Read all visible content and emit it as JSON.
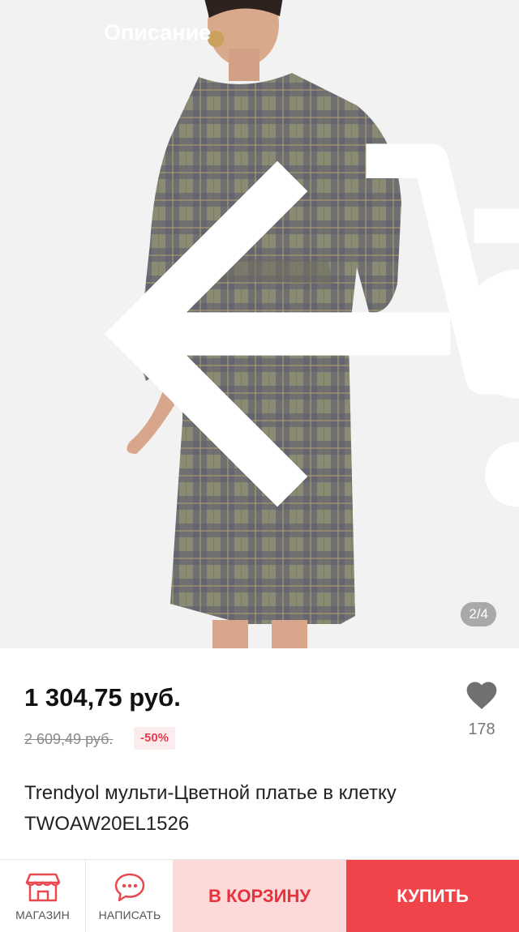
{
  "header": {
    "title": "Описание",
    "icons": [
      "arrow-back-icon",
      "cart-icon",
      "share-icon",
      "more-vert-icon"
    ]
  },
  "gallery": {
    "counter": "2/4",
    "image_subject": "model-in-plaid-dress"
  },
  "product": {
    "price": "1 304,75 руб.",
    "old_price": "2 609,49 руб.",
    "discount": "-50%",
    "favorites_count": "178",
    "name": "Trendyol мульти-Цветной платье в клетку TWOAW20EL1526"
  },
  "bottom_bar": {
    "store_label": "МАГАЗИН",
    "message_label": "НАПИСАТЬ",
    "add_to_cart_label": "В КОРЗИНУ",
    "buy_label": "КУПИТЬ"
  },
  "colors": {
    "accent_red": "#f1444a",
    "cart_bg": "#fdd9d9",
    "discount_bg": "#fdecee"
  }
}
